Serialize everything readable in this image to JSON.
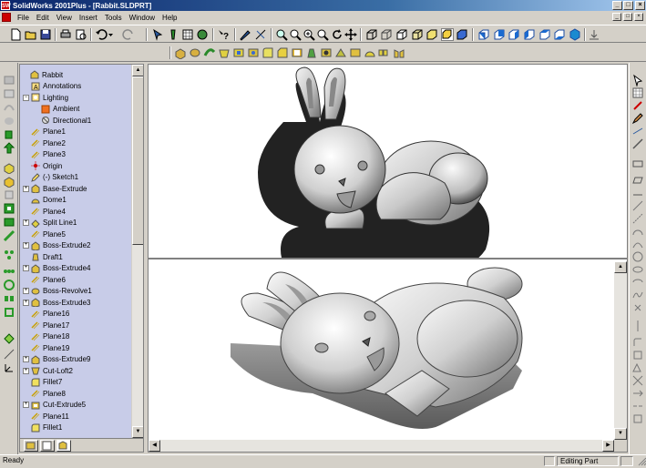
{
  "window": {
    "title": "SolidWorks 2001Plus - [Rabbit.SLDPRT]",
    "app_icon_text": "SW"
  },
  "menu": {
    "items": [
      "File",
      "Edit",
      "View",
      "Insert",
      "Tools",
      "Window",
      "Help"
    ]
  },
  "feature_tree": {
    "items": [
      {
        "label": "Rabbit",
        "icon": "part-icon",
        "expand": "none",
        "indent": 0
      },
      {
        "label": "Annotations",
        "icon": "annotations-icon",
        "expand": "none",
        "indent": 1
      },
      {
        "label": "Lighting",
        "icon": "lighting-icon",
        "expand": "minus",
        "indent": 1
      },
      {
        "label": "Ambient",
        "icon": "ambient-light-icon",
        "expand": "none",
        "indent": 2
      },
      {
        "label": "Directional1",
        "icon": "directional-light-icon",
        "expand": "none",
        "indent": 2
      },
      {
        "label": "Plane1",
        "icon": "plane-icon",
        "expand": "none",
        "indent": 1
      },
      {
        "label": "Plane2",
        "icon": "plane-icon",
        "expand": "none",
        "indent": 1
      },
      {
        "label": "Plane3",
        "icon": "plane-icon",
        "expand": "none",
        "indent": 1
      },
      {
        "label": "Origin",
        "icon": "origin-icon",
        "expand": "none",
        "indent": 1
      },
      {
        "label": "(-) Sketch1",
        "icon": "sketch-icon",
        "expand": "none",
        "indent": 1
      },
      {
        "label": "Base-Extrude",
        "icon": "extrude-icon",
        "expand": "plus",
        "indent": 1
      },
      {
        "label": "Dome1",
        "icon": "dome-icon",
        "expand": "none",
        "indent": 1
      },
      {
        "label": "Plane4",
        "icon": "plane-icon",
        "expand": "none",
        "indent": 1
      },
      {
        "label": "Split Line1",
        "icon": "split-line-icon",
        "expand": "plus",
        "indent": 1
      },
      {
        "label": "Plane5",
        "icon": "plane-icon",
        "expand": "none",
        "indent": 1
      },
      {
        "label": "Boss-Extrude2",
        "icon": "extrude-icon",
        "expand": "plus",
        "indent": 1
      },
      {
        "label": "Draft1",
        "icon": "draft-icon",
        "expand": "none",
        "indent": 1
      },
      {
        "label": "Boss-Extrude4",
        "icon": "extrude-icon",
        "expand": "plus",
        "indent": 1
      },
      {
        "label": "Plane6",
        "icon": "plane-icon",
        "expand": "none",
        "indent": 1
      },
      {
        "label": "Boss-Revolve1",
        "icon": "revolve-icon",
        "expand": "plus",
        "indent": 1
      },
      {
        "label": "Boss-Extrude3",
        "icon": "extrude-icon",
        "expand": "plus",
        "indent": 1
      },
      {
        "label": "Plane16",
        "icon": "plane-icon",
        "expand": "none",
        "indent": 1
      },
      {
        "label": "Plane17",
        "icon": "plane-icon",
        "expand": "none",
        "indent": 1
      },
      {
        "label": "Plane18",
        "icon": "plane-icon",
        "expand": "none",
        "indent": 1
      },
      {
        "label": "Plane19",
        "icon": "plane-icon",
        "expand": "none",
        "indent": 1
      },
      {
        "label": "Boss-Extrude9",
        "icon": "extrude-icon",
        "expand": "plus",
        "indent": 1
      },
      {
        "label": "Cut-Loft2",
        "icon": "cut-loft-icon",
        "expand": "plus",
        "indent": 1
      },
      {
        "label": "Fillet7",
        "icon": "fillet-icon",
        "expand": "none",
        "indent": 1
      },
      {
        "label": "Plane8",
        "icon": "plane-icon",
        "expand": "none",
        "indent": 1
      },
      {
        "label": "Cut-Extrude5",
        "icon": "cut-extrude-icon",
        "expand": "plus",
        "indent": 1
      },
      {
        "label": "Plane11",
        "icon": "plane-icon",
        "expand": "none",
        "indent": 1
      },
      {
        "label": "Fillet1",
        "icon": "fillet-icon",
        "expand": "none",
        "indent": 1
      }
    ]
  },
  "status_bar": {
    "left": "Ready",
    "right": "Editing Part"
  },
  "colors": {
    "title_start": "#0a246a",
    "title_end": "#a6caf0",
    "tree_bg": "#c8cce8",
    "face": "#d4d0c8"
  }
}
